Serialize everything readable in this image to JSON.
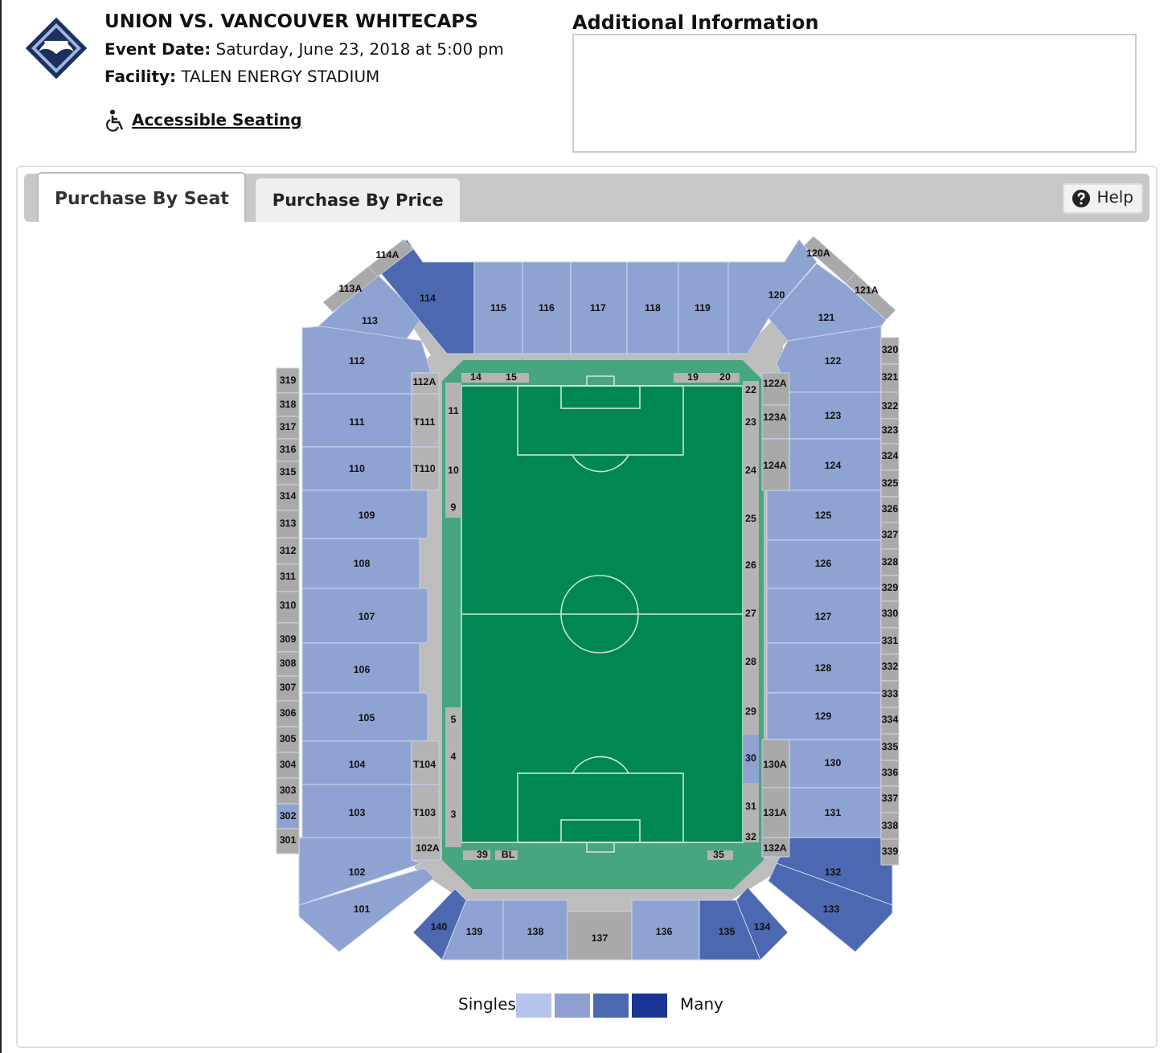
{
  "event": {
    "title": "UNION VS. VANCOUVER WHITECAPS",
    "date_label": "Event Date:",
    "date": "Saturday, June 23, 2018 at 5:00 pm",
    "facility_label": "Facility:",
    "facility": "TALEN ENERGY STADIUM",
    "accessible_link": "Accessible Seating"
  },
  "additional_info": {
    "title": "Additional Information"
  },
  "tabs": [
    {
      "label": "Purchase By Seat",
      "selected": true
    },
    {
      "label": "Purchase By Price",
      "selected": false
    }
  ],
  "help_button": "Help",
  "sections": [
    {
      "label": "113",
      "color": "#8fa3d2"
    },
    {
      "label": "114",
      "color": "#4c68b0"
    },
    {
      "label": "113A",
      "color": "#a9a9a9"
    },
    {
      "label": "114A",
      "color": "#a9a9a9"
    },
    {
      "label": "115",
      "color": "#8fa3d2"
    },
    {
      "label": "116",
      "color": "#8fa3d2"
    },
    {
      "label": "117",
      "color": "#8fa3d2"
    },
    {
      "label": "118",
      "color": "#8fa3d2"
    },
    {
      "label": "119",
      "color": "#8fa3d2"
    },
    {
      "label": "120",
      "color": "#8fa3d2"
    },
    {
      "label": "120A",
      "color": "#a9a9a9"
    },
    {
      "label": "121",
      "color": "#8fa3d2"
    },
    {
      "label": "121A",
      "color": "#a9a9a9"
    },
    {
      "label": "112",
      "color": "#8fa3d2"
    },
    {
      "label": "112A",
      "color": "#b4b4b4"
    },
    {
      "label": "111",
      "color": "#8fa3d2"
    },
    {
      "label": "T111",
      "color": "#b4b4b4"
    },
    {
      "label": "110",
      "color": "#8fa3d2"
    },
    {
      "label": "T110",
      "color": "#b4b4b4"
    },
    {
      "label": "109",
      "color": "#8fa3d2"
    },
    {
      "label": "108",
      "color": "#8fa3d2"
    },
    {
      "label": "107",
      "color": "#8fa3d2"
    },
    {
      "label": "106",
      "color": "#8fa3d2"
    },
    {
      "label": "105",
      "color": "#8fa3d2"
    },
    {
      "label": "104",
      "color": "#8fa3d2"
    },
    {
      "label": "T104",
      "color": "#b4b4b4"
    },
    {
      "label": "103",
      "color": "#8fa3d2"
    },
    {
      "label": "T103",
      "color": "#b4b4b4"
    },
    {
      "label": "102A",
      "color": "#b4b4b4"
    },
    {
      "label": "102",
      "color": "#8fa3d2"
    },
    {
      "label": "122",
      "color": "#8fa3d2"
    },
    {
      "label": "123",
      "color": "#8fa3d2"
    },
    {
      "label": "124",
      "color": "#8fa3d2"
    },
    {
      "label": "125",
      "color": "#8fa3d2"
    },
    {
      "label": "126",
      "color": "#8fa3d2"
    },
    {
      "label": "127",
      "color": "#8fa3d2"
    },
    {
      "label": "128",
      "color": "#8fa3d2"
    },
    {
      "label": "129",
      "color": "#8fa3d2"
    },
    {
      "label": "130",
      "color": "#8fa3d2"
    },
    {
      "label": "131",
      "color": "#8fa3d2"
    },
    {
      "label": "132",
      "color": "#4c68b0"
    },
    {
      "label": "122A",
      "color": "#a9a9a9"
    },
    {
      "label": "123A",
      "color": "#a9a9a9"
    },
    {
      "label": "124A",
      "color": "#a9a9a9"
    },
    {
      "label": "130A",
      "color": "#a9a9a9"
    },
    {
      "label": "131A",
      "color": "#a9a9a9"
    },
    {
      "label": "132A",
      "color": "#a9a9a9"
    },
    {
      "label": "101",
      "color": "#8fa3d2"
    },
    {
      "label": "140",
      "color": "#4c68b0"
    },
    {
      "label": "139",
      "color": "#8fa3d2"
    },
    {
      "label": "138",
      "color": "#8fa3d2"
    },
    {
      "label": "137",
      "color": "#a9a9a9"
    },
    {
      "label": "136",
      "color": "#8fa3d2"
    },
    {
      "label": "135",
      "color": "#4c68b0"
    },
    {
      "label": "134",
      "color": "#4c68b0"
    },
    {
      "label": "133",
      "color": "#4c68b0"
    }
  ],
  "left_upper_sections": [
    {
      "label": "319",
      "color": "#a9a9a9"
    },
    {
      "label": "318",
      "color": "#a9a9a9"
    },
    {
      "label": "317",
      "color": "#a9a9a9"
    },
    {
      "label": "316",
      "color": "#a9a9a9"
    },
    {
      "label": "315",
      "color": "#a9a9a9"
    },
    {
      "label": "314",
      "color": "#a9a9a9"
    },
    {
      "label": "313",
      "color": "#a9a9a9"
    },
    {
      "label": "312",
      "color": "#a9a9a9"
    },
    {
      "label": "311",
      "color": "#a9a9a9"
    },
    {
      "label": "310",
      "color": "#a9a9a9"
    },
    {
      "label": "309",
      "color": "#a9a9a9"
    },
    {
      "label": "308",
      "color": "#a9a9a9"
    },
    {
      "label": "307",
      "color": "#a9a9a9"
    },
    {
      "label": "306",
      "color": "#a9a9a9"
    },
    {
      "label": "305",
      "color": "#a9a9a9"
    },
    {
      "label": "304",
      "color": "#a9a9a9"
    },
    {
      "label": "303",
      "color": "#a9a9a9"
    },
    {
      "label": "302",
      "color": "#8fa3d2"
    },
    {
      "label": "301",
      "color": "#a9a9a9"
    }
  ],
  "right_upper_sections": [
    {
      "label": "320",
      "color": "#a9a9a9"
    },
    {
      "label": "321",
      "color": "#a9a9a9"
    },
    {
      "label": "322",
      "color": "#a9a9a9"
    },
    {
      "label": "323",
      "color": "#a9a9a9"
    },
    {
      "label": "324",
      "color": "#a9a9a9"
    },
    {
      "label": "325",
      "color": "#a9a9a9"
    },
    {
      "label": "326",
      "color": "#a9a9a9"
    },
    {
      "label": "327",
      "color": "#a9a9a9"
    },
    {
      "label": "328",
      "color": "#a9a9a9"
    },
    {
      "label": "329",
      "color": "#a9a9a9"
    },
    {
      "label": "330",
      "color": "#a9a9a9"
    },
    {
      "label": "331",
      "color": "#a9a9a9"
    },
    {
      "label": "332",
      "color": "#a9a9a9"
    },
    {
      "label": "333",
      "color": "#a9a9a9"
    },
    {
      "label": "334",
      "color": "#a9a9a9"
    },
    {
      "label": "335",
      "color": "#a9a9a9"
    },
    {
      "label": "336",
      "color": "#a9a9a9"
    },
    {
      "label": "337",
      "color": "#a9a9a9"
    },
    {
      "label": "338",
      "color": "#a9a9a9"
    },
    {
      "label": "339",
      "color": "#a9a9a9"
    }
  ],
  "field_boxes": [
    {
      "label": "14",
      "color": "#b4b4b4"
    },
    {
      "label": "15",
      "color": "#b4b4b4"
    },
    {
      "label": "19",
      "color": "#b4b4b4"
    },
    {
      "label": "20",
      "color": "#b4b4b4"
    },
    {
      "label": "11",
      "color": "#b4b4b4"
    },
    {
      "label": "10",
      "color": "#b4b4b4"
    },
    {
      "label": "9",
      "color": "#b4b4b4"
    },
    {
      "label": "5",
      "color": "#b4b4b4"
    },
    {
      "label": "4",
      "color": "#b4b4b4"
    },
    {
      "label": "3",
      "color": "#b4b4b4"
    },
    {
      "label": "22",
      "color": "#b4b4b4"
    },
    {
      "label": "23",
      "color": "#b4b4b4"
    },
    {
      "label": "24",
      "color": "#b4b4b4"
    },
    {
      "label": "25",
      "color": "#b4b4b4"
    },
    {
      "label": "26",
      "color": "#b4b4b4"
    },
    {
      "label": "27",
      "color": "#b4b4b4"
    },
    {
      "label": "28",
      "color": "#b4b4b4"
    },
    {
      "label": "29",
      "color": "#b4b4b4"
    },
    {
      "label": "30",
      "color": "#8fa3d2"
    },
    {
      "label": "31",
      "color": "#b4b4b4"
    },
    {
      "label": "32",
      "color": "#b4b4b4"
    },
    {
      "label": "39",
      "color": "#b4b4b4"
    },
    {
      "label": "BL",
      "color": "#b4b4b4"
    },
    {
      "label": "35",
      "color": "#b4b4b4"
    }
  ],
  "legend": {
    "low_label": "Singles",
    "high_label": "Many",
    "swatches": [
      {
        "color": "#b7c4ee"
      },
      {
        "color": "#8fa0d0"
      },
      {
        "color": "#4c68b2"
      },
      {
        "color": "#1a3496"
      }
    ]
  }
}
